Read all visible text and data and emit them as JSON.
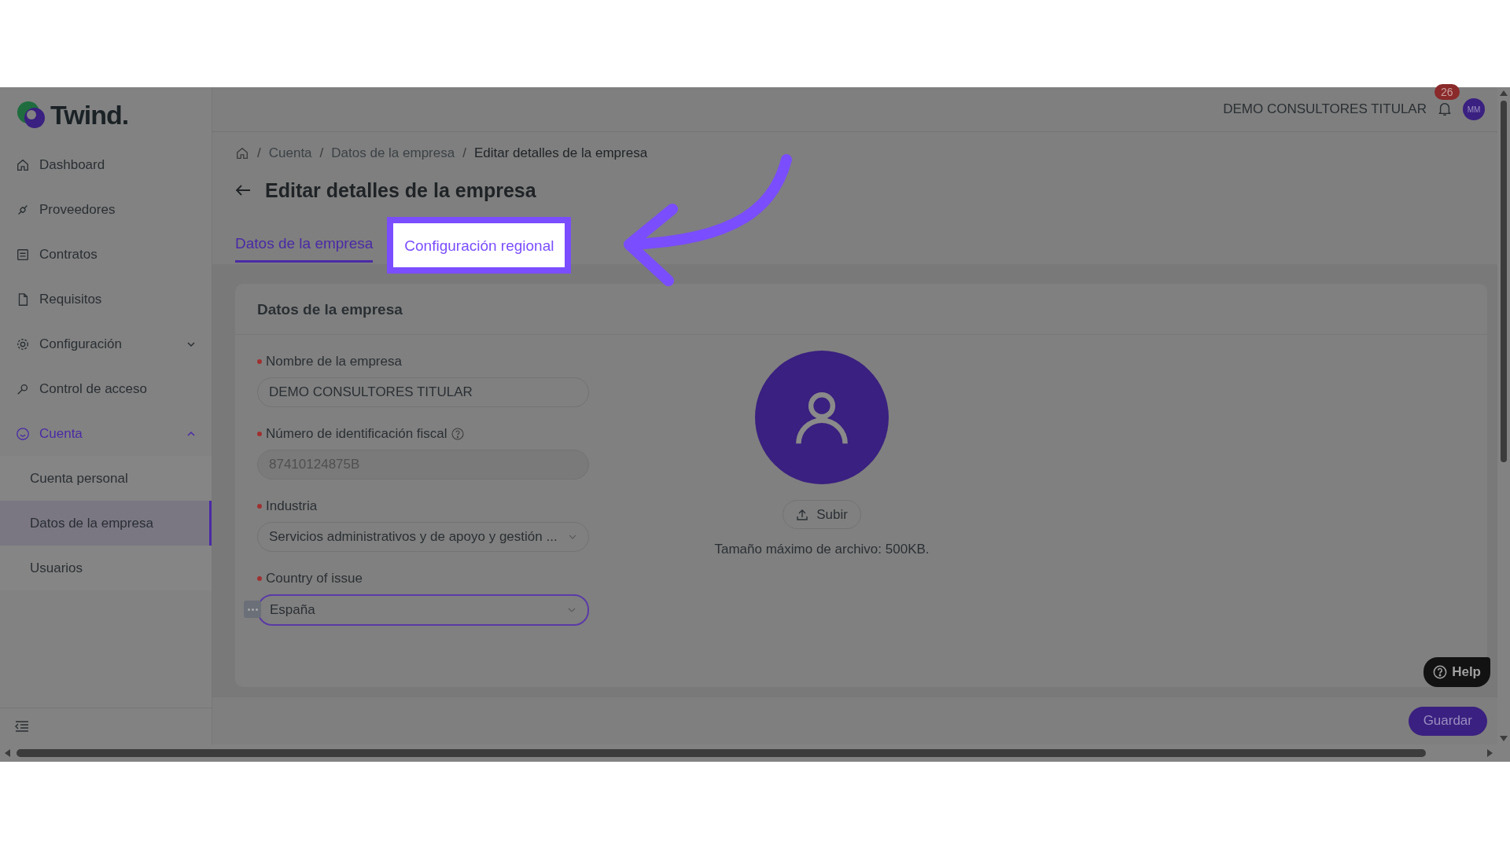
{
  "logo": {
    "text": "Twind."
  },
  "sidebar": {
    "items": [
      {
        "label": "Dashboard",
        "kind": "home",
        "selected": false
      },
      {
        "label": "Proveedores",
        "kind": "link",
        "selected": false
      },
      {
        "label": "Contratos",
        "kind": "contract",
        "selected": false
      },
      {
        "label": "Requisitos",
        "kind": "file",
        "selected": false
      },
      {
        "label": "Configuración",
        "kind": "gear",
        "selected": false,
        "expanded": false
      },
      {
        "label": "Control de acceso",
        "kind": "key",
        "selected": false
      },
      {
        "label": "Cuenta",
        "kind": "smile",
        "selected": true,
        "expanded": true,
        "children": [
          {
            "label": "Cuenta personal",
            "selected": false
          },
          {
            "label": "Datos de la empresa",
            "selected": true
          },
          {
            "label": "Usuarios",
            "selected": false
          }
        ]
      }
    ]
  },
  "header": {
    "company": "DEMO CONSULTORES TITULAR",
    "notifications": "26",
    "avatar": "MM"
  },
  "breadcrumb": [
    {
      "separator": "/",
      "label": "Cuenta"
    },
    {
      "separator": "/",
      "label": "Datos de la empresa"
    },
    {
      "separator": "/",
      "label": "Editar detalles de la empresa"
    }
  ],
  "title": "Editar detalles de la empresa",
  "tabs": [
    {
      "label": "Datos de la empresa",
      "selected": true,
      "highlighted": false
    },
    {
      "label": "Configuración regional",
      "selected": false,
      "highlighted": true
    }
  ],
  "card": {
    "title": "Datos de la empresa",
    "fields": [
      {
        "label": "Nombre de la empresa",
        "required": true,
        "help": false,
        "kind": "text",
        "value": "DEMO CONSULTORES TITULAR"
      },
      {
        "label": "Número de identificación fiscal",
        "required": true,
        "help": true,
        "kind": "disabled",
        "value": "87410124875B"
      },
      {
        "label": "Industria",
        "required": true,
        "help": false,
        "kind": "select",
        "value": "Servicios administrativos y de apoyo y gestión ..."
      },
      {
        "label": "Country of issue",
        "required": true,
        "help": false,
        "kind": "select-focused",
        "value": "España"
      }
    ],
    "upload": {
      "button": "Subir",
      "note": "Tamaño máximo de archivo: 500KB."
    }
  },
  "help_button": "Help",
  "save_button": "Guardar"
}
